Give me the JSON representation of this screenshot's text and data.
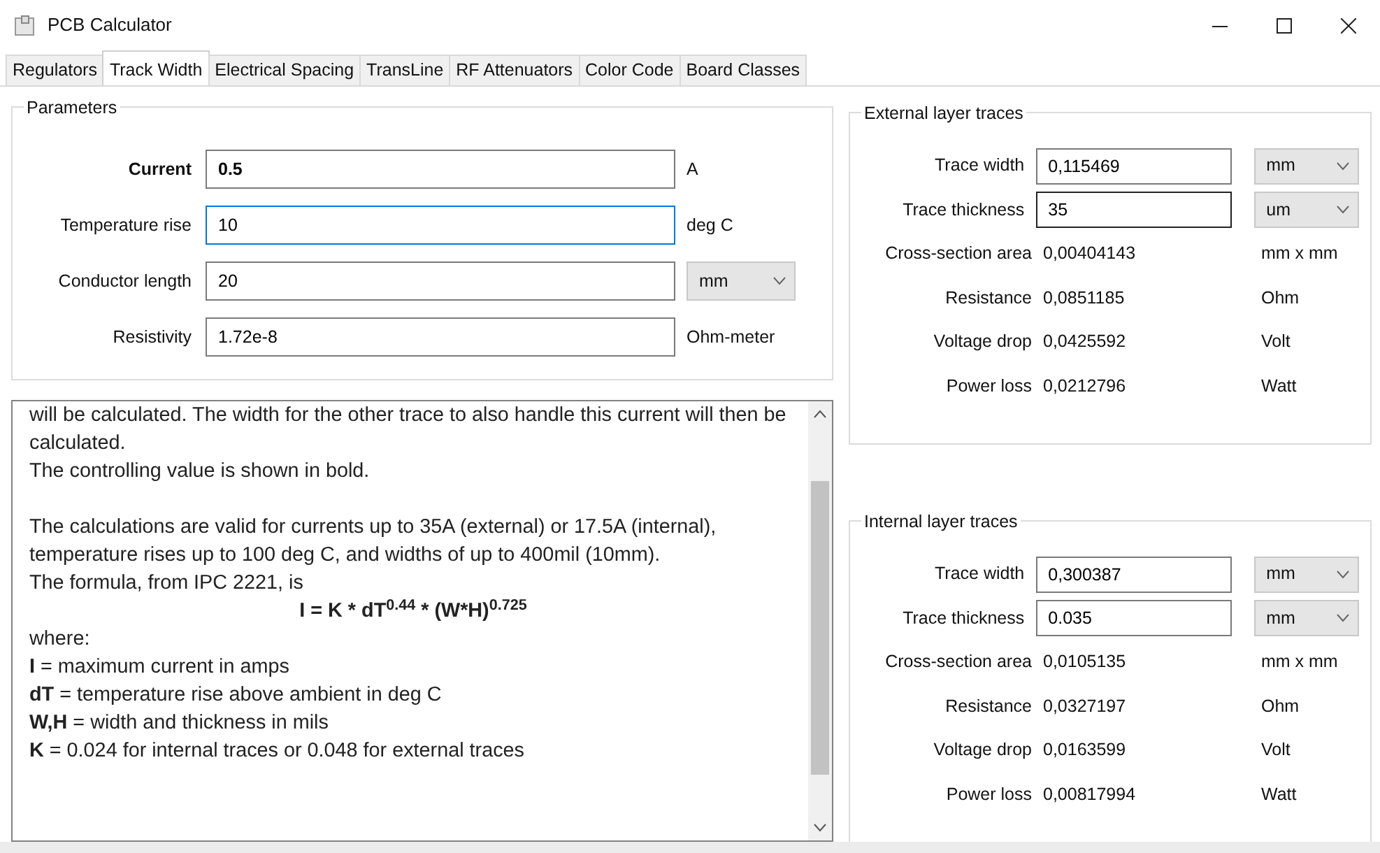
{
  "window": {
    "title": "PCB Calculator"
  },
  "tabs": [
    {
      "label": "Regulators",
      "selected": false
    },
    {
      "label": "Track Width",
      "selected": true
    },
    {
      "label": "Electrical Spacing",
      "selected": false
    },
    {
      "label": "TransLine",
      "selected": false
    },
    {
      "label": "RF Attenuators",
      "selected": false
    },
    {
      "label": "Color Code",
      "selected": false
    },
    {
      "label": "Board Classes",
      "selected": false
    }
  ],
  "parameters": {
    "title": "Parameters",
    "rows": [
      {
        "label": "Current",
        "value": "0.5",
        "unit": "A",
        "kind": "text",
        "controlling": true,
        "focused": false
      },
      {
        "label": "Temperature rise",
        "value": "10",
        "unit": "deg C",
        "kind": "text",
        "controlling": false,
        "focused": true
      },
      {
        "label": "Conductor length",
        "value": "20",
        "unit": "mm",
        "kind": "dropdown",
        "controlling": false,
        "focused": false
      },
      {
        "label": "Resistivity",
        "value": "1.72e-8",
        "unit": "Ohm-meter",
        "kind": "text",
        "controlling": false,
        "focused": false
      }
    ]
  },
  "description": [
    {
      "kind": "line",
      "text": "will be calculated. The width for the other trace to also handle this current will then be calculated."
    },
    {
      "kind": "line",
      "text": "The controlling value is shown in bold."
    },
    {
      "kind": "paragraph",
      "text": "The calculations are valid for currents up to 35A (external) or 17.5A (internal), temperature rises up to 100 deg C, and widths of up to 400mil (10mm)."
    },
    {
      "kind": "line",
      "text": "The formula, from IPC 2221, is"
    },
    {
      "kind": "formula",
      "text": "I = K * dT$^{0.44}$ * (W*H)$^{0.725}$"
    },
    {
      "kind": "line",
      "text": "where:"
    },
    {
      "kind": "line",
      "text": "**I** = maximum current in amps"
    },
    {
      "kind": "line",
      "text": "**dT** = temperature rise above ambient in deg C"
    },
    {
      "kind": "line",
      "text": "**W,H** = width and thickness in mils"
    },
    {
      "kind": "line",
      "text": "**K** = 0.024 for internal traces or 0.048 for external traces"
    }
  ],
  "layers": [
    {
      "title": "External layer traces",
      "rows": [
        {
          "kind": "field",
          "label": "Trace width",
          "value": "0,115469",
          "unit": "mm",
          "hovered": false
        },
        {
          "kind": "field",
          "label": "Trace thickness",
          "value": "35",
          "unit": "um",
          "hovered": true
        },
        {
          "kind": "result",
          "label": "Cross-section area",
          "value": "0,00404143",
          "unit": "mm x mm"
        },
        {
          "kind": "result",
          "label": "Resistance",
          "value": "0,0851185",
          "unit": "Ohm"
        },
        {
          "kind": "result",
          "label": "Voltage drop",
          "value": "0,0425592",
          "unit": "Volt"
        },
        {
          "kind": "result",
          "label": "Power loss",
          "value": "0,0212796",
          "unit": "Watt"
        }
      ]
    },
    {
      "title": "Internal layer traces",
      "rows": [
        {
          "kind": "field",
          "label": "Trace width",
          "value": "0,300387",
          "unit": "mm",
          "hovered": false
        },
        {
          "kind": "field",
          "label": "Trace thickness",
          "value": "0.035",
          "unit": "mm",
          "hovered": false
        },
        {
          "kind": "result",
          "label": "Cross-section area",
          "value": "0,0105135",
          "unit": "mm x mm"
        },
        {
          "kind": "result",
          "label": "Resistance",
          "value": "0,0327197",
          "unit": "Ohm"
        },
        {
          "kind": "result",
          "label": "Voltage drop",
          "value": "0,0163599",
          "unit": "Volt"
        },
        {
          "kind": "result",
          "label": "Power loss",
          "value": "0,00817994",
          "unit": "Watt"
        }
      ]
    }
  ]
}
